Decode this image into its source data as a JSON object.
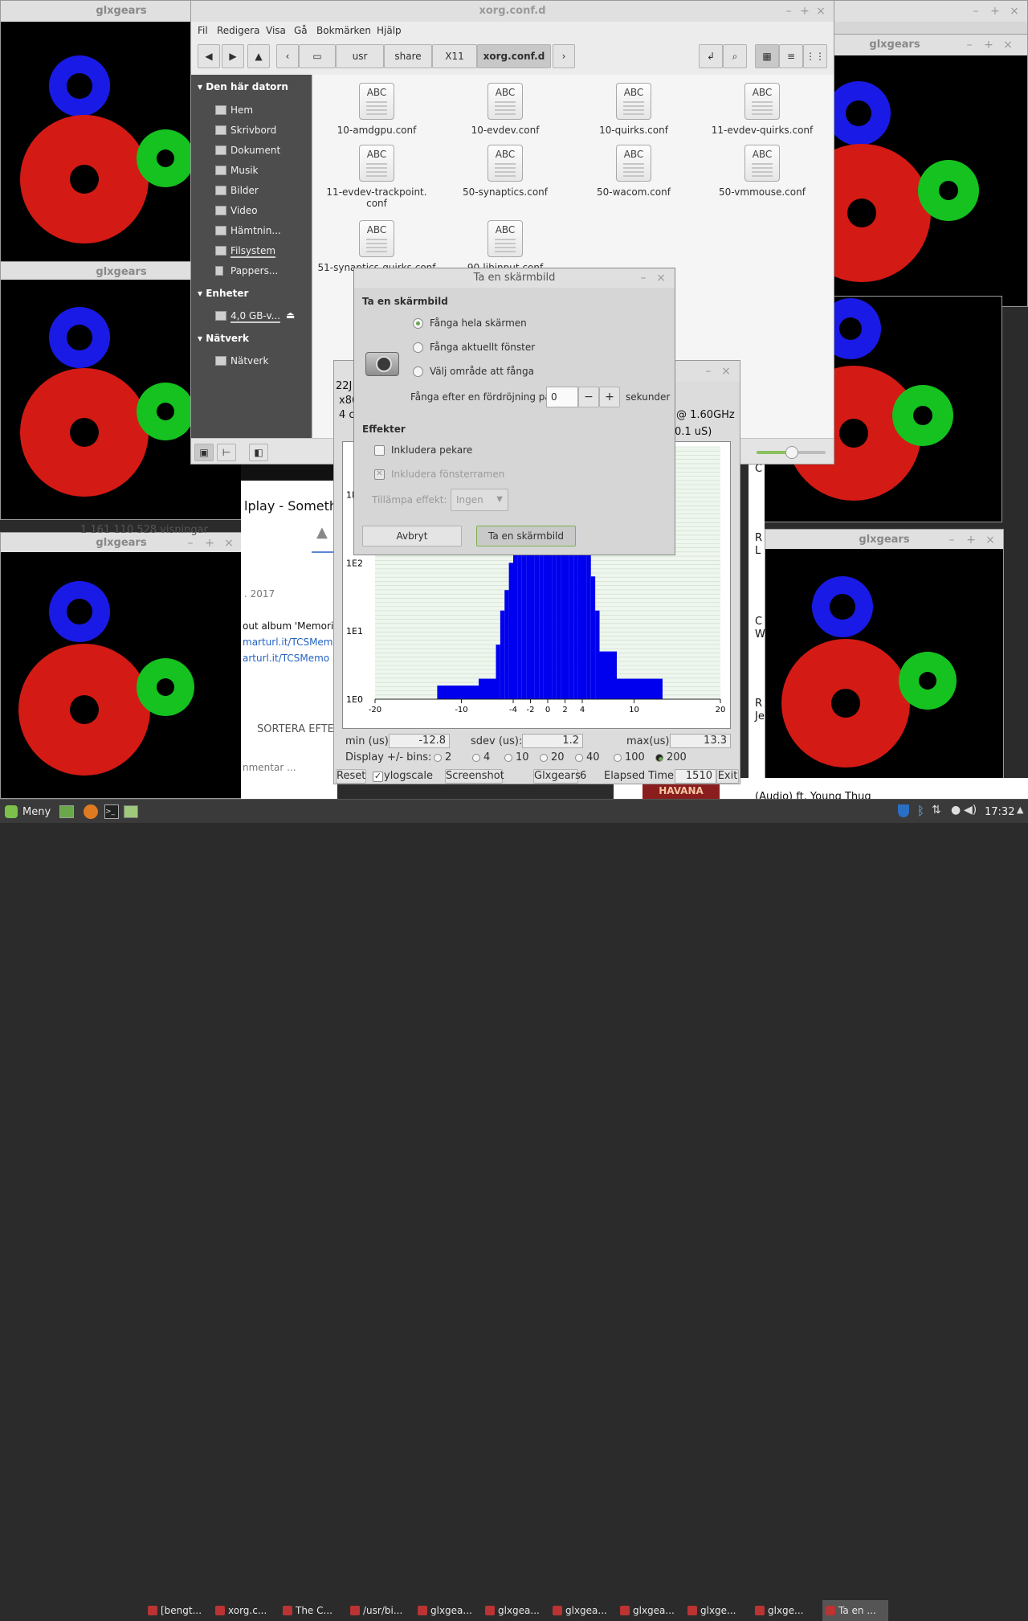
{
  "gears_title": "glxgears",
  "nemo": {
    "title": "xorg.conf.d",
    "menu": [
      "Fil",
      "Redigera",
      "Visa",
      "Gå",
      "Bokmärken",
      "Hjälp"
    ],
    "crumbs": [
      "usr",
      "share",
      "X11",
      "xorg.conf.d"
    ],
    "sidebar": {
      "sec1": "Den här datorn",
      "items1": [
        "Hem",
        "Skrivbord",
        "Dokument",
        "Musik",
        "Bilder",
        "Video",
        "Hämtnin...",
        "Filsystem",
        "Pappers..."
      ],
      "sec2": "Enheter",
      "items2": [
        "4,0 GB-v..."
      ],
      "sec3": "Nätverk",
      "items3": [
        "Nätverk"
      ]
    },
    "files": [
      "10-amdgpu.conf",
      "10-evdev.conf",
      "10-quirks.conf",
      "11-evdev-quirks.conf",
      "11-evdev-trackpoint.\nconf",
      "50-synaptics.conf",
      "50-wacom.conf",
      "50-vmmouse.conf",
      "51-synaptics-quirks.conf",
      "90-libinput.conf"
    ],
    "file_icon_text": "ABC"
  },
  "screenshot": {
    "title": "Ta en skärmbild",
    "heading": "Ta en skärmbild",
    "opt1": "Fånga hela skärmen",
    "opt2": "Fånga aktuellt fönster",
    "opt3": "Välj område att fånga",
    "delay_label": "Fånga efter en fördröjning på",
    "delay_value": "0",
    "delay_unit": "sekunder",
    "effects_heading": "Effekter",
    "include_pointer": "Inkludera pekare",
    "include_border": "Inkludera fönsterramen",
    "effect_label": "Tillämpa effekt:",
    "effect_value": "Ingen",
    "cancel": "Avbryt",
    "take": "Ta en skärmbild"
  },
  "latency": {
    "line1": "22J",
    "line2": "x86",
    "line3": "4 c",
    "freq": "@ 1.60GHz",
    "unit_label": "0.1 uS)",
    "min_label": "min (us)",
    "min_value": "-12.8",
    "sdev_label": "sdev (us):",
    "sdev_value": "1.2",
    "max_label": "max(us)",
    "max_value": "13.3",
    "bins_label": "Display +/- bins:",
    "bins": [
      "2",
      "4",
      "10",
      "20",
      "40",
      "100",
      "200"
    ],
    "reset": "Reset",
    "ylog": "ylogscale",
    "screenshot_btn": "Screenshot",
    "glx_label": "Glxgears",
    "glx_value": "6",
    "elapsed_label": "Elapsed Time:",
    "elapsed_value": "1510",
    "exit": "Exit"
  },
  "chart_data": {
    "type": "bar",
    "title": "",
    "xlabel": "",
    "ylabel": "",
    "x_ticks": [
      "-20",
      "-10",
      "-4",
      "-2",
      "0",
      "2",
      "4",
      "10",
      "20"
    ],
    "y_ticks": [
      "1E0",
      "1E1",
      "1E2",
      "1E3"
    ],
    "ylog": true,
    "xlim": [
      -20,
      20
    ],
    "ylim_log10": [
      0,
      3.7
    ],
    "series": [
      {
        "x": [
          -12.8,
          -8,
          -6,
          -5.5,
          -5,
          -4.5,
          -4,
          -3.5,
          -3,
          -2.5,
          -2,
          -1.5,
          -1,
          -0.5,
          0,
          0.5,
          1,
          1.5,
          2,
          2.5,
          3,
          3.5,
          4,
          4.5,
          5,
          5.5,
          6,
          8,
          13.3
        ],
        "log10": [
          0.2,
          0.3,
          0.8,
          1.3,
          1.6,
          2.0,
          2.5,
          2.9,
          3.2,
          3.35,
          3.45,
          3.5,
          3.5,
          3.5,
          3.5,
          3.5,
          3.5,
          3.5,
          3.45,
          3.4,
          3.35,
          3.2,
          3.0,
          2.5,
          1.8,
          1.3,
          0.7,
          0.3,
          0.2
        ]
      }
    ]
  },
  "web": {
    "title_fragment": "lplay - Someth",
    "views": "1 161 110 528 visningar",
    "year": ". 2017",
    "desc": "out album 'Memorie",
    "link1": "marturl.it/TCSMem",
    "link2": "arturl.it/TCSMemo",
    "sort": "SORTERA EFTE",
    "comment": "nmentar ...",
    "right": [
      "C",
      "R",
      "L",
      "C",
      "W",
      "R",
      "Je"
    ],
    "bottom_right": "(Audio) ft. Young Thug",
    "thumb_text": "HAVANA"
  },
  "taskbar": {
    "menu": "Meny",
    "tasks": [
      "[bengt...",
      "xorg.c...",
      "The C...",
      "/usr/bi...",
      "glxgea...",
      "glxgea...",
      "glxgea...",
      "glxgea...",
      "glxge...",
      "glxge...",
      "Ta en ..."
    ],
    "clock": "17:32"
  }
}
